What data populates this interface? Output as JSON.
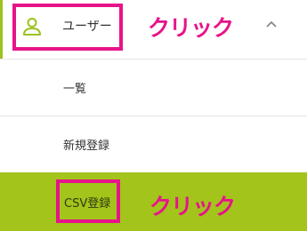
{
  "menu": {
    "user": {
      "label": "ユーザー",
      "icon": "user-icon",
      "expanded": true,
      "toggle_icon": "chevron-up-icon"
    },
    "subitems": [
      {
        "label": "一覧"
      },
      {
        "label": "新規登録"
      },
      {
        "label": "CSV登録",
        "active": true
      }
    ]
  },
  "annotations": {
    "click_label_1": "クリック",
    "click_label_2": "クリック"
  },
  "colors": {
    "accent_green": "#a3c41b",
    "highlight_pink": "#e7138a",
    "text": "#333333"
  }
}
